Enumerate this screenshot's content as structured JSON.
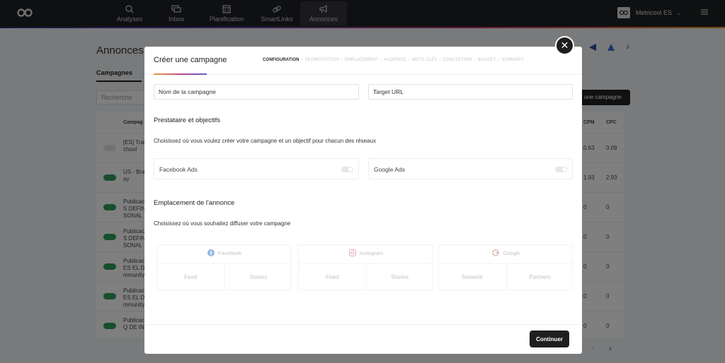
{
  "nav": {
    "items": [
      {
        "label": "Analyses",
        "icon": "analytics-icon"
      },
      {
        "label": "Inbox",
        "icon": "inbox-icon"
      },
      {
        "label": "Planification",
        "icon": "calendar-icon"
      },
      {
        "label": "SmartLinks",
        "icon": "link-icon"
      },
      {
        "label": "Annonces",
        "icon": "megaphone-icon",
        "active": true
      }
    ],
    "account_name": "Metricool ES"
  },
  "background": {
    "title": "Annonces",
    "tab": "Campagnes",
    "search_placeholder": "Recherche",
    "new_campaign_button": "r une campagne",
    "columns": {
      "campaign": "Campag",
      "cpm": "CPM",
      "cpc": "CPC"
    },
    "rows": [
      {
        "name": "[ES] Traf... chool",
        "cpm": "0.63",
        "cpc": "0.09",
        "enabled": false
      },
      {
        "name": "US - Bra... ay",
        "cpm": "1.93",
        "cpc": "2.93",
        "enabled": true
      },
      {
        "name": "Publicac... S DEFIN... SONAL",
        "cpm": "0",
        "cpc": "0",
        "enabled": true
      },
      {
        "name": "Publicac... S DEFIN... SONAL",
        "cpm": "0",
        "cpc": "0",
        "enabled": true
      },
      {
        "name": "Publicac... ES EL DI... mmunity",
        "cpm": "0",
        "cpc": "0",
        "enabled": true
      },
      {
        "name": "Publicac... ES EL DI... mmunity",
        "cpm": "0",
        "cpc": "0",
        "enabled": true
      },
      {
        "name": "Publicac... Q DE IN...",
        "cpm": "0",
        "cpc": "0",
        "enabled": true
      }
    ]
  },
  "modal": {
    "title": "Créer une campagne",
    "steps": [
      "CONFIGURATION",
      "SEGMENTATION",
      "EMPLACEMENT",
      "AUDIENCE",
      "MOTS CLÉS",
      "CONCEPTION",
      "BUDGET",
      "SUMMARY"
    ],
    "campaign_name_placeholder": "Nom de la campagne",
    "target_url_placeholder": "Target URL",
    "providers_title": "Prestataire et objectifs",
    "providers_desc": "Choisissez où vous voulez créer votre campagne et un objectif pour chacun des réseaux",
    "providers": [
      {
        "label": "Facebook Ads",
        "enabled": false
      },
      {
        "label": "Google Ads",
        "enabled": false
      }
    ],
    "placement_title": "Emplacement de l'annonce",
    "placement_desc": "Choisissez où vous souhaitez diffuser votre campagne",
    "placements": [
      {
        "network": "Facebook",
        "icon": "facebook-icon",
        "options": [
          "Feed",
          "Stories"
        ]
      },
      {
        "network": "Instagram",
        "icon": "instagram-icon",
        "options": [
          "Feed",
          "Stories"
        ]
      },
      {
        "network": "Google",
        "icon": "google-icon",
        "options": [
          "Network",
          "Partners"
        ]
      }
    ],
    "continue_label": "Continuer"
  }
}
